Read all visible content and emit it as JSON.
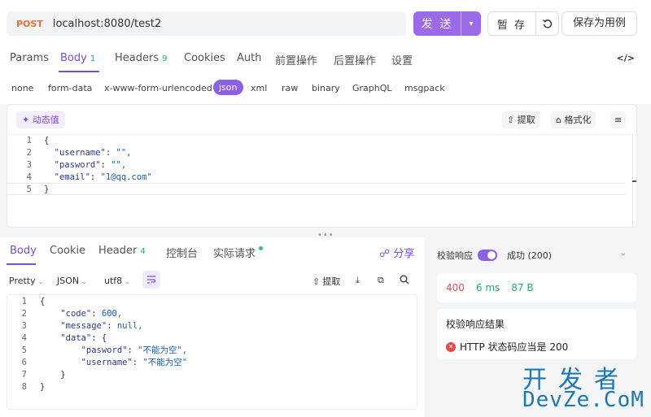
{
  "request": {
    "method": "POST",
    "url": "localhost:8080/test2",
    "send_label": "发 送",
    "stash_label": "暂 存",
    "save_case_label": "保存为用例"
  },
  "request_tabs": [
    {
      "label": "Params",
      "count": ""
    },
    {
      "label": "Body",
      "count": "1"
    },
    {
      "label": "Headers",
      "count": "9"
    },
    {
      "label": "Cookies",
      "count": ""
    },
    {
      "label": "Auth",
      "count": ""
    },
    {
      "label": "前置操作",
      "count": ""
    },
    {
      "label": "后置操作",
      "count": ""
    },
    {
      "label": "设置",
      "count": ""
    }
  ],
  "code_toggle": "</>",
  "body_types": [
    "none",
    "form-data",
    "x-www-form-urlencoded",
    "json",
    "xml",
    "raw",
    "binary",
    "GraphQL",
    "msgpack"
  ],
  "editor": {
    "dynamic_value_label": "动态值",
    "extract_label": "提取",
    "format_label": "格式化",
    "lines": [
      {
        "n": "1",
        "text": "{"
      },
      {
        "n": "2",
        "key": "\"username\"",
        "val": "\"\","
      },
      {
        "n": "3",
        "key": "\"pasword\"",
        "val": "\"\","
      },
      {
        "n": "4",
        "key": "\"email\"",
        "val": "\"1@qq.com\""
      },
      {
        "n": "5",
        "text": "}"
      }
    ]
  },
  "splitter": "•••",
  "response_tabs": [
    {
      "label": "Body",
      "count": ""
    },
    {
      "label": "Cookie",
      "count": ""
    },
    {
      "label": "Header",
      "count": "4"
    },
    {
      "label": "控制台",
      "count": ""
    },
    {
      "label": "实际请求",
      "count": ""
    }
  ],
  "share_label": "分享",
  "response_format": {
    "pretty": "Pretty",
    "json": "JSON",
    "encoding": "utf8",
    "extract_label": "提取"
  },
  "response_lines": [
    {
      "n": "1",
      "indent": "",
      "text": "{"
    },
    {
      "n": "2",
      "indent": "    ",
      "key": "\"code\"",
      "val": "600,"
    },
    {
      "n": "3",
      "indent": "    ",
      "key": "\"message\"",
      "val": "null,"
    },
    {
      "n": "4",
      "indent": "    ",
      "key": "\"data\"",
      "val": "{"
    },
    {
      "n": "5",
      "indent": "        ",
      "key": "\"pasword\"",
      "val": "\"不能为空\","
    },
    {
      "n": "6",
      "indent": "        ",
      "key": "\"username\"",
      "val": "\"不能为空\""
    },
    {
      "n": "7",
      "indent": "    ",
      "text": "}"
    },
    {
      "n": "8",
      "indent": "",
      "text": "}"
    }
  ],
  "verify": {
    "label": "校验响应",
    "status": "成功 (200)"
  },
  "stats": {
    "status_code": "400",
    "time": "6 ms",
    "size": "87 B"
  },
  "result": {
    "title": "校验响应结果",
    "item": "HTTP 状态码应当是 200"
  },
  "watermark": {
    "cn": "开发者",
    "en": "DevZe.CoM"
  },
  "colors": {
    "accent": "#7c4ddb",
    "send_button": "#9b6ae8",
    "method": "#e8713a",
    "status_error": "#e5484d",
    "size_green": "#2aa876",
    "watermark": "#1f78b4"
  }
}
